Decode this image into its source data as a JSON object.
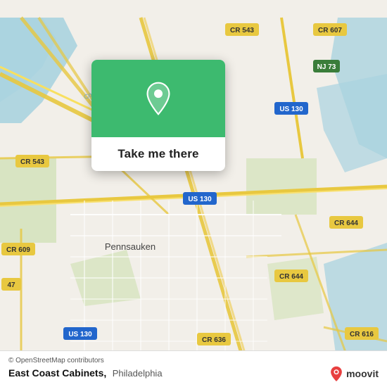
{
  "map": {
    "attribution": "© OpenStreetMap contributors",
    "background_color": "#f2efe9"
  },
  "popup": {
    "header_color": "#3dba6f",
    "button_label": "Take me there",
    "pin_color": "#ffffff"
  },
  "bottom_bar": {
    "attribution": "© OpenStreetMap contributors",
    "location_name": "East Coast Cabinets,",
    "location_city": "Philadelphia",
    "brand": "moovit"
  }
}
